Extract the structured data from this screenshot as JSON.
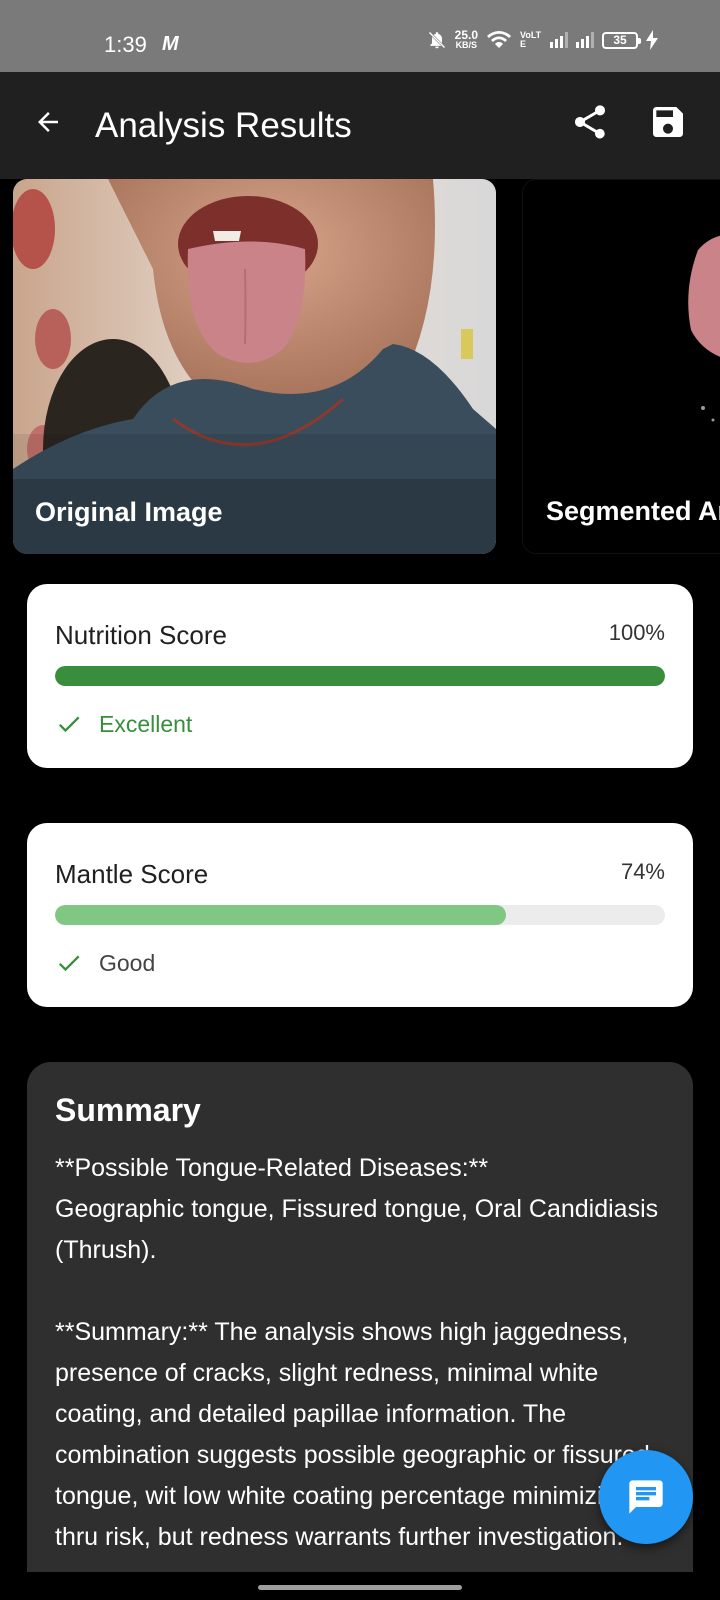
{
  "status_bar": {
    "time": "1:39",
    "carrier_icon_label": "M",
    "net_speed": "25.0",
    "net_speed_unit": "KB/S",
    "volte_label": "VoLTE",
    "battery_level": "35",
    "icons": [
      "mute-bell-icon",
      "wifi-icon",
      "signal-icon",
      "signal-icon",
      "battery-icon",
      "charging-icon"
    ]
  },
  "app_bar": {
    "title": "Analysis Results",
    "icons": [
      "back-arrow-icon",
      "share-icon",
      "save-icon"
    ]
  },
  "images": [
    {
      "caption": "Original Image"
    },
    {
      "caption": "Segmented Ar"
    }
  ],
  "scores": {
    "nutrition": {
      "label": "Nutrition Score",
      "value_text": "100%",
      "value": 1.0,
      "status": "Excellent",
      "color": "#388e3c"
    },
    "mantle": {
      "label": "Mantle Score",
      "value_text": "74%",
      "value": 0.74,
      "status": "Good",
      "color": "#81c784"
    }
  },
  "summary": {
    "title": "Summary",
    "body": "**Possible Tongue-Related Diseases:**\nGeographic tongue, Fissured tongue, Oral Candidiasis (Thrush).\n\n**Summary:** The analysis shows high jaggedness, presence of cracks, slight redness, minimal white coating, and detailed papillae information. The combination suggests possible geographic or fissured tongue, wit low white coating percentage minimizing thru risk, but redness warrants further investigation."
  },
  "colors": {
    "accent": "#2196f3",
    "app_bar_bg": "#202020",
    "status_bar_bg": "#7a7a7a",
    "summary_bg": "#2f2f2f"
  }
}
